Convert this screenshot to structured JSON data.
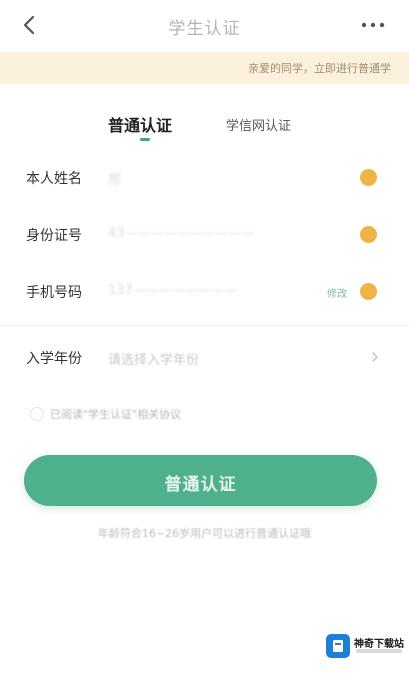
{
  "header": {
    "title": "学生认证"
  },
  "notice": {
    "text": "亲爱的同学，立即进行普通学"
  },
  "tabs": [
    {
      "label": "普通认证",
      "active": true
    },
    {
      "label": "学信网认证",
      "active": false
    }
  ],
  "form": {
    "rows": [
      {
        "label": "本人姓名",
        "value": "邢"
      },
      {
        "label": "身份证号",
        "value": "43——————————"
      },
      {
        "label": "手机号码",
        "value": "137————————",
        "action": "修改"
      }
    ],
    "enroll": {
      "label": "入学年份",
      "placeholder": "请选择入学年份"
    }
  },
  "agreement": {
    "text": "已阅读\"学生认证\"相关协议"
  },
  "submit": {
    "label": "普通认证"
  },
  "footnote": {
    "text": "年龄符合16~26岁用户可以进行普通认证哦"
  },
  "watermark": {
    "text": "神奇下载站"
  },
  "colors": {
    "accent": "#4fb08c",
    "status_dot": "#f0b345",
    "notice_bg": "#fbf1dd"
  }
}
